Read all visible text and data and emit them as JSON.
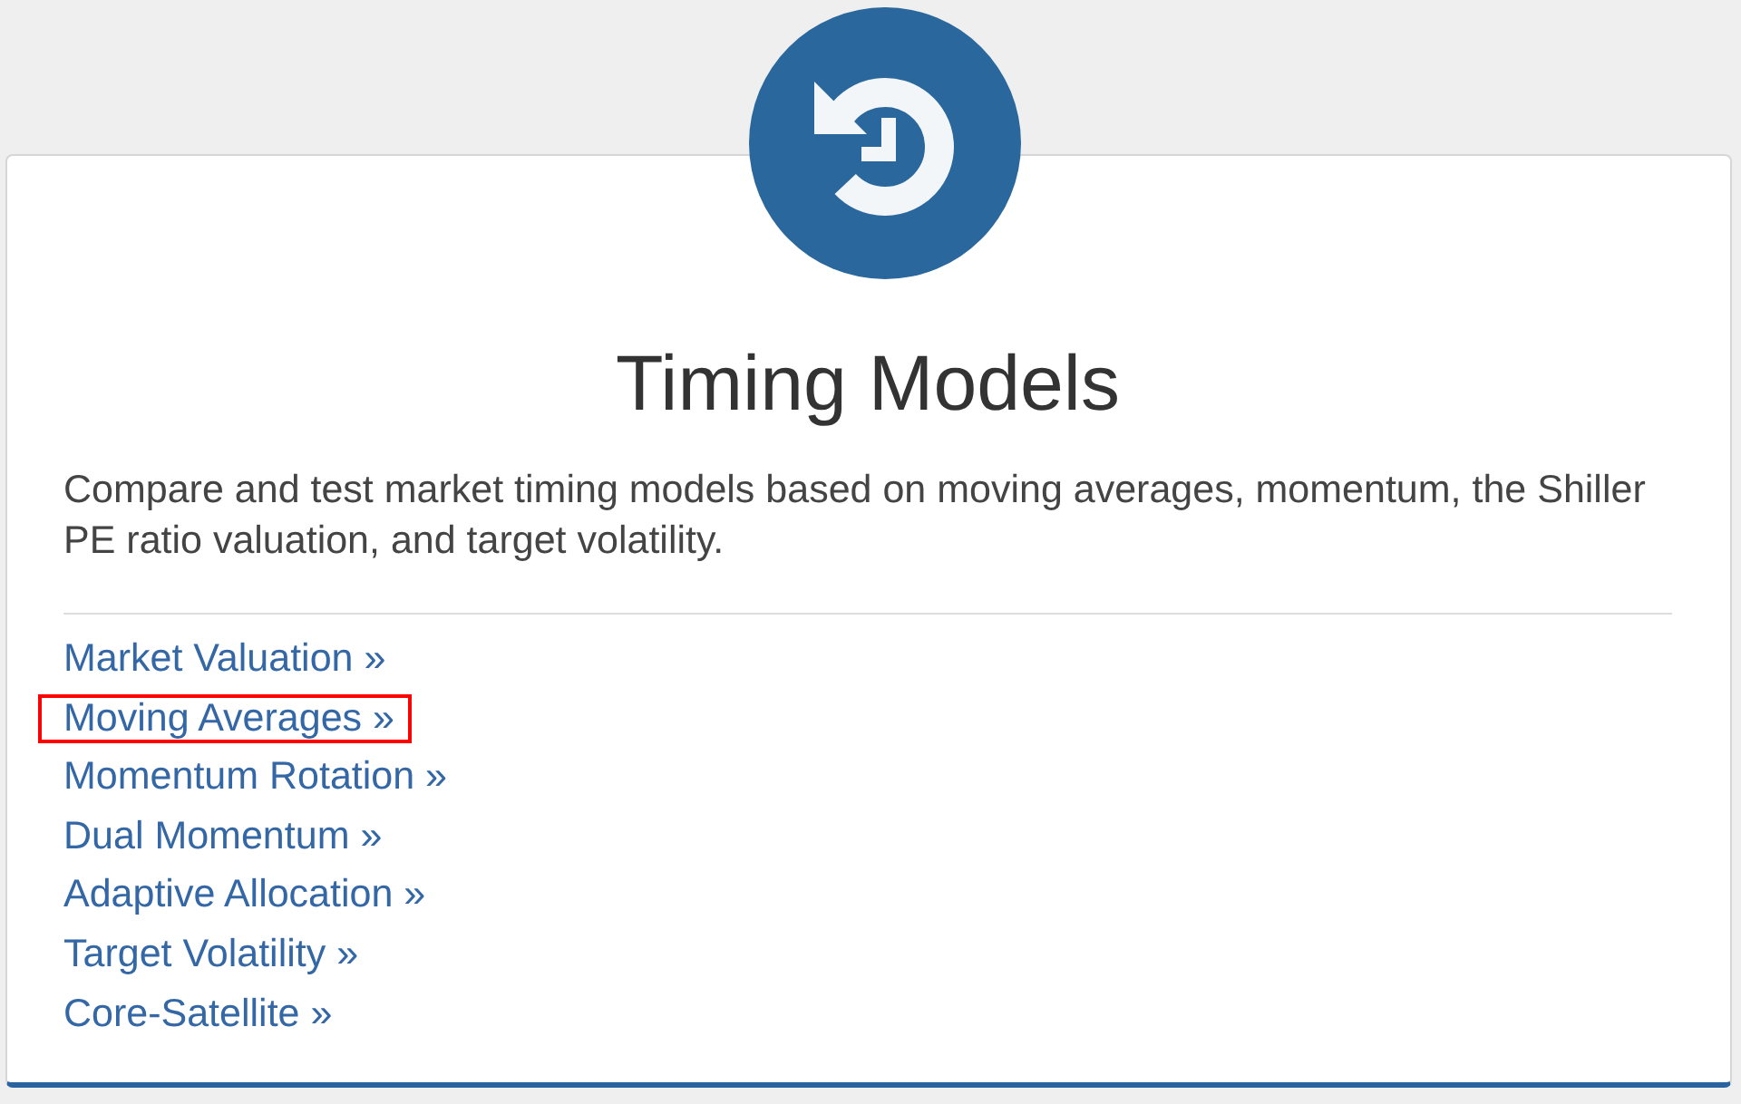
{
  "card": {
    "title": "Timing Models",
    "description": "Compare and test market timing models based on moving averages, momentum, the Shiller PE ratio valuation, and target volatility.",
    "links": [
      {
        "label": "Market Valuation »",
        "highlighted": false
      },
      {
        "label": "Moving Averages »",
        "highlighted": true
      },
      {
        "label": "Momentum Rotation »",
        "highlighted": false
      },
      {
        "label": "Dual Momentum »",
        "highlighted": false
      },
      {
        "label": "Adaptive Allocation »",
        "highlighted": false
      },
      {
        "label": "Target Volatility »",
        "highlighted": false
      },
      {
        "label": "Core-Satellite »",
        "highlighted": false
      }
    ]
  }
}
